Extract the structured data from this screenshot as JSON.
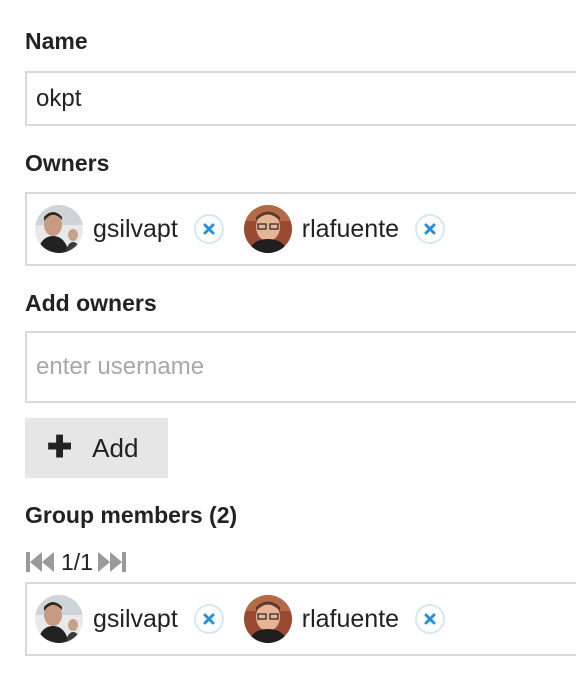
{
  "name_section": {
    "label": "Name",
    "value": "okpt"
  },
  "owners_section": {
    "label": "Owners",
    "owners": [
      {
        "username": "gsilvapt",
        "avatar": "user-avatar"
      },
      {
        "username": "rlafuente",
        "avatar": "user-avatar"
      }
    ]
  },
  "add_owners_section": {
    "label": "Add owners",
    "placeholder": "enter username",
    "add_button_label": "Add",
    "add_button_icon": "plus-icon"
  },
  "members_section": {
    "label": "Group members (2)",
    "pager": {
      "page_text": "1/1",
      "first_icon": "first-page-icon",
      "last_icon": "last-page-icon"
    },
    "members": [
      {
        "username": "gsilvapt",
        "avatar": "user-avatar"
      },
      {
        "username": "rlafuente",
        "avatar": "user-avatar"
      }
    ]
  },
  "colors": {
    "remove_icon": "#2b8fd6",
    "disabled_nav": "#9a9a9a",
    "border": "#d9d9d9",
    "button_bg": "#e6e6e6"
  }
}
